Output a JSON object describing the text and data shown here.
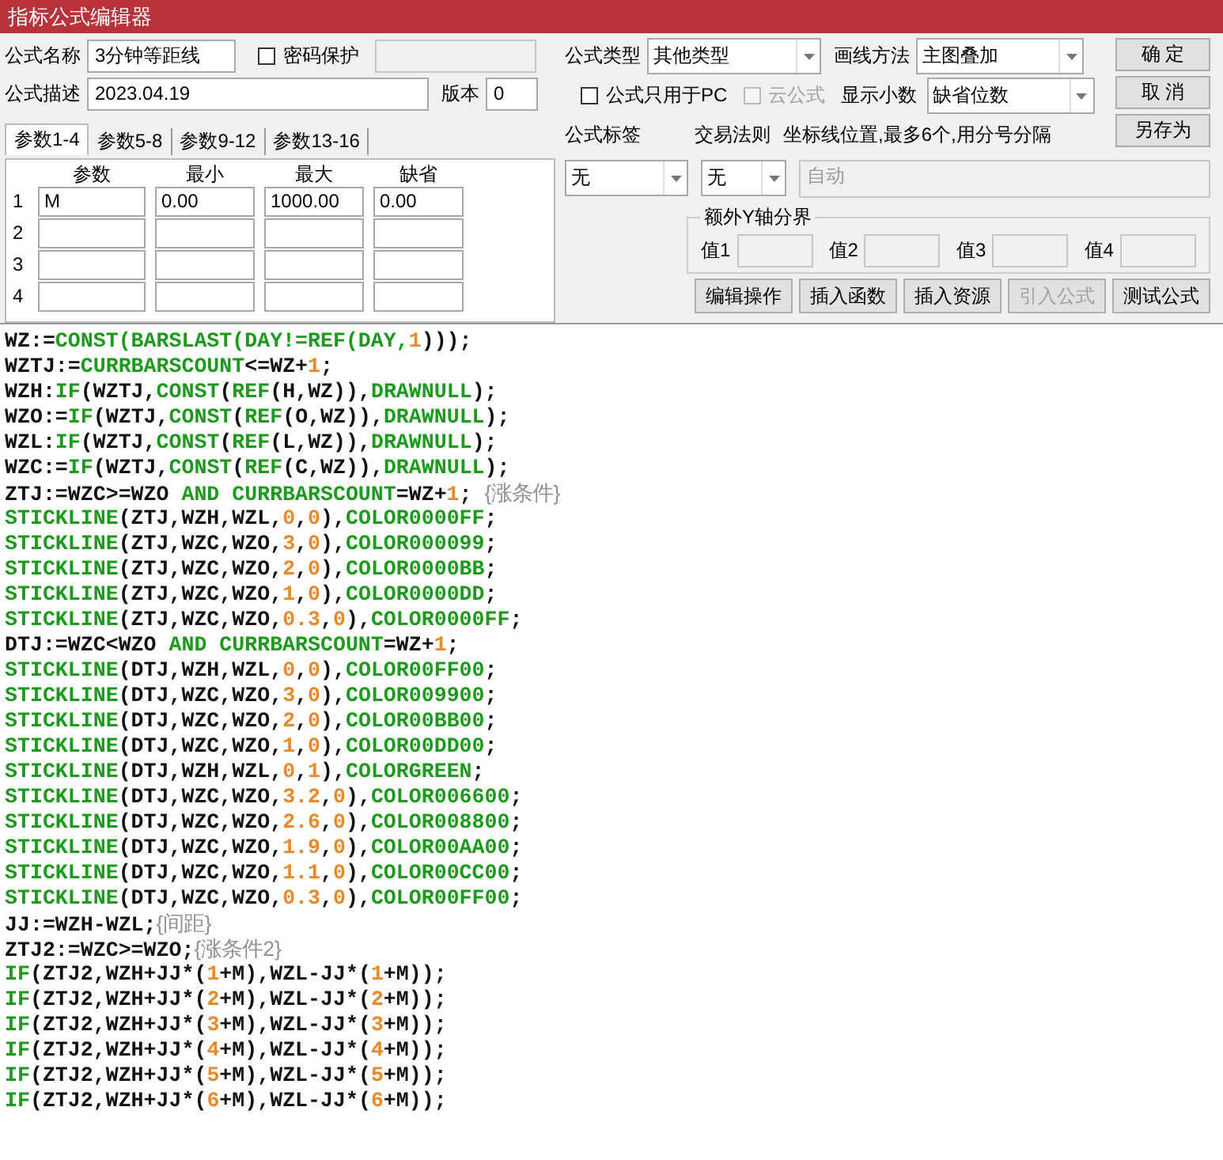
{
  "window": {
    "title": "指标公式编辑器"
  },
  "name_field": {
    "label": "公式名称",
    "value": "3分钟等距线"
  },
  "password": {
    "label": "密码保护",
    "checked": false
  },
  "description_field": {
    "label": "公式描述",
    "value": "2023.04.19"
  },
  "version_field": {
    "label": "版本",
    "value": "0"
  },
  "formula_type": {
    "label": "公式类型",
    "value": "其他类型"
  },
  "draw_method": {
    "label": "画线方法",
    "value": "主图叠加"
  },
  "pc_only": {
    "label": "公式只用于PC",
    "checked": false,
    "disabled": false
  },
  "cloud": {
    "label": "云公式",
    "checked": false,
    "disabled": true
  },
  "decimals": {
    "label": "显示小数",
    "value": "缺省位数"
  },
  "side_buttons": [
    {
      "label": "确 定"
    },
    {
      "label": "取 消"
    },
    {
      "label": "另存为"
    }
  ],
  "tabs": [
    {
      "label": "参数1-4",
      "selected": true
    },
    {
      "label": "参数5-8",
      "selected": false
    },
    {
      "label": "参数9-12",
      "selected": false
    },
    {
      "label": "参数13-16",
      "selected": false
    }
  ],
  "param_columns": [
    "参数",
    "最小",
    "最大",
    "缺省"
  ],
  "params": [
    {
      "index": "1",
      "name": "M",
      "min": "0.00",
      "max": "1000.00",
      "default": "0.00"
    },
    {
      "index": "2"
    },
    {
      "index": "3"
    },
    {
      "index": "4"
    }
  ],
  "formula_tag": {
    "label": "公式标签",
    "value": "无"
  },
  "trade_rule": {
    "label": "交易法则",
    "value": "无"
  },
  "axis_lines": {
    "label": "坐标线位置,最多6个,用分号分隔",
    "placeholder": "自动"
  },
  "y_bounds": {
    "title": "额外Y轴分界",
    "fields": [
      {
        "label": "值1"
      },
      {
        "label": "值2"
      },
      {
        "label": "值3"
      },
      {
        "label": "值4"
      }
    ]
  },
  "action_buttons": [
    {
      "label": "编辑操作",
      "disabled": false
    },
    {
      "label": "插入函数",
      "disabled": false
    },
    {
      "label": "插入资源",
      "disabled": false
    },
    {
      "label": "引入公式",
      "disabled": true
    },
    {
      "label": "测试公式",
      "disabled": false
    }
  ],
  "code": [
    [
      {
        "kind": "plain",
        "text": "WZ:="
      },
      {
        "kind": "keyword",
        "text": "CONST(BARSLAST(DAY!=REF(DAY,"
      },
      {
        "kind": "number",
        "text": "1"
      },
      {
        "kind": "plain",
        "text": ")));"
      }
    ],
    [
      {
        "kind": "plain",
        "text": "WZTJ:="
      },
      {
        "kind": "keyword",
        "text": "CURRBARSCOUNT"
      },
      {
        "kind": "plain",
        "text": "<=WZ+"
      },
      {
        "kind": "number",
        "text": "1"
      },
      {
        "kind": "plain",
        "text": ";"
      }
    ],
    [
      {
        "kind": "plain",
        "text": "WZH:"
      },
      {
        "kind": "keyword",
        "text": "IF"
      },
      {
        "kind": "plain",
        "text": "(WZTJ,"
      },
      {
        "kind": "keyword",
        "text": "CONST"
      },
      {
        "kind": "plain",
        "text": "("
      },
      {
        "kind": "keyword",
        "text": "REF"
      },
      {
        "kind": "plain",
        "text": "(H,WZ)),"
      },
      {
        "kind": "keyword",
        "text": "DRAWNULL"
      },
      {
        "kind": "plain",
        "text": ");"
      }
    ],
    [
      {
        "kind": "plain",
        "text": "WZO:="
      },
      {
        "kind": "keyword",
        "text": "IF"
      },
      {
        "kind": "plain",
        "text": "(WZTJ,"
      },
      {
        "kind": "keyword",
        "text": "CONST"
      },
      {
        "kind": "plain",
        "text": "("
      },
      {
        "kind": "keyword",
        "text": "REF"
      },
      {
        "kind": "plain",
        "text": "(O,WZ)),"
      },
      {
        "kind": "keyword",
        "text": "DRAWNULL"
      },
      {
        "kind": "plain",
        "text": ");"
      }
    ],
    [
      {
        "kind": "plain",
        "text": "WZL:"
      },
      {
        "kind": "keyword",
        "text": "IF"
      },
      {
        "kind": "plain",
        "text": "(WZTJ,"
      },
      {
        "kind": "keyword",
        "text": "CONST"
      },
      {
        "kind": "plain",
        "text": "("
      },
      {
        "kind": "keyword",
        "text": "REF"
      },
      {
        "kind": "plain",
        "text": "(L,WZ)),"
      },
      {
        "kind": "keyword",
        "text": "DRAWNULL"
      },
      {
        "kind": "plain",
        "text": ");"
      }
    ],
    [
      {
        "kind": "plain",
        "text": "WZC:="
      },
      {
        "kind": "keyword",
        "text": "IF"
      },
      {
        "kind": "plain",
        "text": "(WZTJ,"
      },
      {
        "kind": "keyword",
        "text": "CONST"
      },
      {
        "kind": "plain",
        "text": "("
      },
      {
        "kind": "keyword",
        "text": "REF"
      },
      {
        "kind": "plain",
        "text": "(C,WZ)),"
      },
      {
        "kind": "keyword",
        "text": "DRAWNULL"
      },
      {
        "kind": "plain",
        "text": ");"
      }
    ],
    [
      {
        "kind": "plain",
        "text": "ZTJ:=WZC>=WZO "
      },
      {
        "kind": "keyword",
        "text": "AND CURRBARSCOUNT"
      },
      {
        "kind": "plain",
        "text": "=WZ+"
      },
      {
        "kind": "number",
        "text": "1"
      },
      {
        "kind": "plain",
        "text": "; "
      },
      {
        "kind": "comment",
        "text": "{涨条件}"
      }
    ],
    [
      {
        "kind": "keyword",
        "text": "STICKLINE"
      },
      {
        "kind": "plain",
        "text": "(ZTJ,WZH,WZL,"
      },
      {
        "kind": "number",
        "text": "0"
      },
      {
        "kind": "plain",
        "text": ","
      },
      {
        "kind": "number",
        "text": "0"
      },
      {
        "kind": "plain",
        "text": "),"
      },
      {
        "kind": "keyword",
        "text": "COLOR0000FF"
      },
      {
        "kind": "plain",
        "text": ";"
      }
    ],
    [
      {
        "kind": "keyword",
        "text": "STICKLINE"
      },
      {
        "kind": "plain",
        "text": "(ZTJ,WZC,WZO,"
      },
      {
        "kind": "number",
        "text": "3"
      },
      {
        "kind": "plain",
        "text": ","
      },
      {
        "kind": "number",
        "text": "0"
      },
      {
        "kind": "plain",
        "text": "),"
      },
      {
        "kind": "keyword",
        "text": "COLOR000099"
      },
      {
        "kind": "plain",
        "text": ";"
      }
    ],
    [
      {
        "kind": "keyword",
        "text": "STICKLINE"
      },
      {
        "kind": "plain",
        "text": "(ZTJ,WZC,WZO,"
      },
      {
        "kind": "number",
        "text": "2"
      },
      {
        "kind": "plain",
        "text": ","
      },
      {
        "kind": "number",
        "text": "0"
      },
      {
        "kind": "plain",
        "text": "),"
      },
      {
        "kind": "keyword",
        "text": "COLOR0000BB"
      },
      {
        "kind": "plain",
        "text": ";"
      }
    ],
    [
      {
        "kind": "keyword",
        "text": "STICKLINE"
      },
      {
        "kind": "plain",
        "text": "(ZTJ,WZC,WZO,"
      },
      {
        "kind": "number",
        "text": "1"
      },
      {
        "kind": "plain",
        "text": ","
      },
      {
        "kind": "number",
        "text": "0"
      },
      {
        "kind": "plain",
        "text": "),"
      },
      {
        "kind": "keyword",
        "text": "COLOR0000DD"
      },
      {
        "kind": "plain",
        "text": ";"
      }
    ],
    [
      {
        "kind": "keyword",
        "text": "STICKLINE"
      },
      {
        "kind": "plain",
        "text": "(ZTJ,WZC,WZO,"
      },
      {
        "kind": "number",
        "text": "0.3"
      },
      {
        "kind": "plain",
        "text": ","
      },
      {
        "kind": "number",
        "text": "0"
      },
      {
        "kind": "plain",
        "text": "),"
      },
      {
        "kind": "keyword",
        "text": "COLOR0000FF"
      },
      {
        "kind": "plain",
        "text": ";"
      }
    ],
    [
      {
        "kind": "plain",
        "text": "DTJ:=WZC<WZO "
      },
      {
        "kind": "keyword",
        "text": "AND CURRBARSCOUNT"
      },
      {
        "kind": "plain",
        "text": "=WZ+"
      },
      {
        "kind": "number",
        "text": "1"
      },
      {
        "kind": "plain",
        "text": ";"
      }
    ],
    [
      {
        "kind": "keyword",
        "text": "STICKLINE"
      },
      {
        "kind": "plain",
        "text": "(DTJ,WZH,WZL,"
      },
      {
        "kind": "number",
        "text": "0"
      },
      {
        "kind": "plain",
        "text": ","
      },
      {
        "kind": "number",
        "text": "0"
      },
      {
        "kind": "plain",
        "text": "),"
      },
      {
        "kind": "keyword",
        "text": "COLOR00FF00"
      },
      {
        "kind": "plain",
        "text": ";"
      }
    ],
    [
      {
        "kind": "keyword",
        "text": "STICKLINE"
      },
      {
        "kind": "plain",
        "text": "(DTJ,WZC,WZO,"
      },
      {
        "kind": "number",
        "text": "3"
      },
      {
        "kind": "plain",
        "text": ","
      },
      {
        "kind": "number",
        "text": "0"
      },
      {
        "kind": "plain",
        "text": "),"
      },
      {
        "kind": "keyword",
        "text": "COLOR009900"
      },
      {
        "kind": "plain",
        "text": ";"
      }
    ],
    [
      {
        "kind": "keyword",
        "text": "STICKLINE"
      },
      {
        "kind": "plain",
        "text": "(DTJ,WZC,WZO,"
      },
      {
        "kind": "number",
        "text": "2"
      },
      {
        "kind": "plain",
        "text": ","
      },
      {
        "kind": "number",
        "text": "0"
      },
      {
        "kind": "plain",
        "text": "),"
      },
      {
        "kind": "keyword",
        "text": "COLOR00BB00"
      },
      {
        "kind": "plain",
        "text": ";"
      }
    ],
    [
      {
        "kind": "keyword",
        "text": "STICKLINE"
      },
      {
        "kind": "plain",
        "text": "(DTJ,WZC,WZO,"
      },
      {
        "kind": "number",
        "text": "1"
      },
      {
        "kind": "plain",
        "text": ","
      },
      {
        "kind": "number",
        "text": "0"
      },
      {
        "kind": "plain",
        "text": "),"
      },
      {
        "kind": "keyword",
        "text": "COLOR00DD00"
      },
      {
        "kind": "plain",
        "text": ";"
      }
    ],
    [
      {
        "kind": "keyword",
        "text": "STICKLINE"
      },
      {
        "kind": "plain",
        "text": "(DTJ,WZH,WZL,"
      },
      {
        "kind": "number",
        "text": "0"
      },
      {
        "kind": "plain",
        "text": ","
      },
      {
        "kind": "number",
        "text": "1"
      },
      {
        "kind": "plain",
        "text": "),"
      },
      {
        "kind": "keyword",
        "text": "COLORGREEN"
      },
      {
        "kind": "plain",
        "text": ";"
      }
    ],
    [
      {
        "kind": "keyword",
        "text": "STICKLINE"
      },
      {
        "kind": "plain",
        "text": "(DTJ,WZC,WZO,"
      },
      {
        "kind": "number",
        "text": "3.2"
      },
      {
        "kind": "plain",
        "text": ","
      },
      {
        "kind": "number",
        "text": "0"
      },
      {
        "kind": "plain",
        "text": "),"
      },
      {
        "kind": "keyword",
        "text": "COLOR006600"
      },
      {
        "kind": "plain",
        "text": ";"
      }
    ],
    [
      {
        "kind": "keyword",
        "text": "STICKLINE"
      },
      {
        "kind": "plain",
        "text": "(DTJ,WZC,WZO,"
      },
      {
        "kind": "number",
        "text": "2.6"
      },
      {
        "kind": "plain",
        "text": ","
      },
      {
        "kind": "number",
        "text": "0"
      },
      {
        "kind": "plain",
        "text": "),"
      },
      {
        "kind": "keyword",
        "text": "COLOR008800"
      },
      {
        "kind": "plain",
        "text": ";"
      }
    ],
    [
      {
        "kind": "keyword",
        "text": "STICKLINE"
      },
      {
        "kind": "plain",
        "text": "(DTJ,WZC,WZO,"
      },
      {
        "kind": "number",
        "text": "1.9"
      },
      {
        "kind": "plain",
        "text": ","
      },
      {
        "kind": "number",
        "text": "0"
      },
      {
        "kind": "plain",
        "text": "),"
      },
      {
        "kind": "keyword",
        "text": "COLOR00AA00"
      },
      {
        "kind": "plain",
        "text": ";"
      }
    ],
    [
      {
        "kind": "keyword",
        "text": "STICKLINE"
      },
      {
        "kind": "plain",
        "text": "(DTJ,WZC,WZO,"
      },
      {
        "kind": "number",
        "text": "1.1"
      },
      {
        "kind": "plain",
        "text": ","
      },
      {
        "kind": "number",
        "text": "0"
      },
      {
        "kind": "plain",
        "text": "),"
      },
      {
        "kind": "keyword",
        "text": "COLOR00CC00"
      },
      {
        "kind": "plain",
        "text": ";"
      }
    ],
    [
      {
        "kind": "keyword",
        "text": "STICKLINE"
      },
      {
        "kind": "plain",
        "text": "(DTJ,WZC,WZO,"
      },
      {
        "kind": "number",
        "text": "0.3"
      },
      {
        "kind": "plain",
        "text": ","
      },
      {
        "kind": "number",
        "text": "0"
      },
      {
        "kind": "plain",
        "text": "),"
      },
      {
        "kind": "keyword",
        "text": "COLOR00FF00"
      },
      {
        "kind": "plain",
        "text": ";"
      }
    ],
    [
      {
        "kind": "plain",
        "text": "JJ:=WZH-WZL;"
      },
      {
        "kind": "comment",
        "text": "{间距}"
      }
    ],
    [
      {
        "kind": "plain",
        "text": "ZTJ2:=WZC>=WZO;"
      },
      {
        "kind": "comment",
        "text": "{涨条件2}"
      }
    ],
    [
      {
        "kind": "keyword",
        "text": "IF"
      },
      {
        "kind": "plain",
        "text": "(ZTJ2,WZH+JJ*("
      },
      {
        "kind": "number",
        "text": "1"
      },
      {
        "kind": "plain",
        "text": "+M),WZL-JJ*("
      },
      {
        "kind": "number",
        "text": "1"
      },
      {
        "kind": "plain",
        "text": "+M));"
      }
    ],
    [
      {
        "kind": "keyword",
        "text": "IF"
      },
      {
        "kind": "plain",
        "text": "(ZTJ2,WZH+JJ*("
      },
      {
        "kind": "number",
        "text": "2"
      },
      {
        "kind": "plain",
        "text": "+M),WZL-JJ*("
      },
      {
        "kind": "number",
        "text": "2"
      },
      {
        "kind": "plain",
        "text": "+M));"
      }
    ],
    [
      {
        "kind": "keyword",
        "text": "IF"
      },
      {
        "kind": "plain",
        "text": "(ZTJ2,WZH+JJ*("
      },
      {
        "kind": "number",
        "text": "3"
      },
      {
        "kind": "plain",
        "text": "+M),WZL-JJ*("
      },
      {
        "kind": "number",
        "text": "3"
      },
      {
        "kind": "plain",
        "text": "+M));"
      }
    ],
    [
      {
        "kind": "keyword",
        "text": "IF"
      },
      {
        "kind": "plain",
        "text": "(ZTJ2,WZH+JJ*("
      },
      {
        "kind": "number",
        "text": "4"
      },
      {
        "kind": "plain",
        "text": "+M),WZL-JJ*("
      },
      {
        "kind": "number",
        "text": "4"
      },
      {
        "kind": "plain",
        "text": "+M));"
      }
    ],
    [
      {
        "kind": "keyword",
        "text": "IF"
      },
      {
        "kind": "plain",
        "text": "(ZTJ2,WZH+JJ*("
      },
      {
        "kind": "number",
        "text": "5"
      },
      {
        "kind": "plain",
        "text": "+M),WZL-JJ*("
      },
      {
        "kind": "number",
        "text": "5"
      },
      {
        "kind": "plain",
        "text": "+M));"
      }
    ],
    [
      {
        "kind": "keyword",
        "text": "IF"
      },
      {
        "kind": "plain",
        "text": "(ZTJ2,WZH+JJ*("
      },
      {
        "kind": "number",
        "text": "6"
      },
      {
        "kind": "plain",
        "text": "+M),WZL-JJ*("
      },
      {
        "kind": "number",
        "text": "6"
      },
      {
        "kind": "plain",
        "text": "+M));"
      }
    ]
  ]
}
